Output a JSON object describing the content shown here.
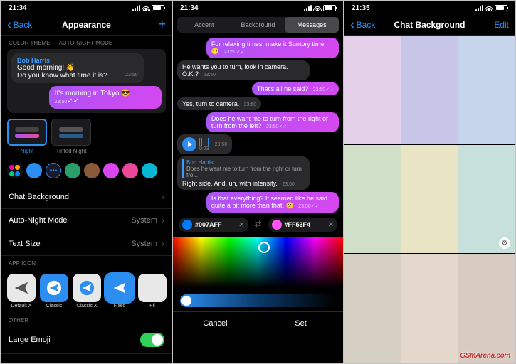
{
  "status": {
    "time1": "21:34",
    "time2": "21:34",
    "time3": "21:35"
  },
  "p1": {
    "back": "Back",
    "title": "Appearance",
    "sect1": "COLOR THEME — AUTO-NIGHT MODE",
    "preview": {
      "name": "Bob Harris",
      "line1": "Good morning! 👋",
      "line2": "Do you know what time it is?",
      "t1": "23:50",
      "out": "It's morning in Tokyo 😎",
      "t2": "23:50"
    },
    "themes": [
      {
        "label": "Night"
      },
      {
        "label": "Tinted Night"
      }
    ],
    "colors": [
      "#2b8ef0",
      "#2b8ef0",
      "#2b9e6b",
      "#8b5a3a",
      "#d946ef",
      "#ec4899",
      "#06b6d4"
    ],
    "rows": {
      "bg": "Chat Background",
      "night": "Auto-Night Mode",
      "nightv": "System",
      "text": "Text Size",
      "textv": "System"
    },
    "sect2": "APP ICON",
    "icons": [
      {
        "l": "Default X"
      },
      {
        "l": "Classic"
      },
      {
        "l": "Classic X"
      },
      {
        "l": "Filled"
      },
      {
        "l": "Fil"
      }
    ],
    "sect3": "OTHER",
    "emoji": "Large Emoji"
  },
  "p2": {
    "tabs": [
      "Accent",
      "Background",
      "Messages"
    ],
    "msgs": [
      {
        "o": true,
        "t": "For relaxing times, make it Suntory time. 😏",
        "ts": "23:50"
      },
      {
        "o": false,
        "t": "He wants you to turn, look in camera. O.K.?",
        "ts": "23:50"
      },
      {
        "o": true,
        "t": "That's all he said?",
        "ts": "23:50"
      },
      {
        "o": false,
        "t": "Yes, turn to camera.",
        "ts": "23:50"
      },
      {
        "o": true,
        "t": "Does he want me to turn from the right or turn from the left?",
        "ts": "23:50"
      }
    ],
    "voice": {
      "dur": "0:23",
      "ts": "23:50"
    },
    "reply": {
      "name": "Bob Harris",
      "quote": "Does he want me to turn from the right or turn fro...",
      "text": "Right side. And, uh, with intensity.",
      "ts": "23:50"
    },
    "last": {
      "t": "Is that everything? It seemed like he said quite a bit more than that. 😕",
      "ts": "23:50"
    },
    "hex1": "#007AFF",
    "hex2": "#FF53F4",
    "cancel": "Cancel",
    "set": "Set"
  },
  "p3": {
    "back": "Back",
    "title": "Chat Background",
    "edit": "Edit",
    "cells": [
      "#e4d0e8",
      "#c8c6e8",
      "#c6d4ec",
      "#d0e0c8",
      "#e8e4c4",
      "#c8e0dc",
      "#d6d0c4",
      "#e4d8cc",
      "#d8ccc2"
    ]
  },
  "watermark": "GSMArena.com"
}
